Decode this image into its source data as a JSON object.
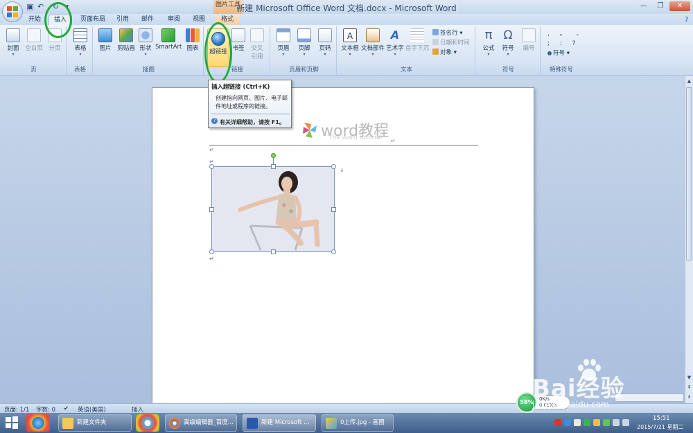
{
  "window": {
    "title": "新建 Microsoft Office Word 文档.docx - Microsoft Word",
    "context_tab_group": "图片工具"
  },
  "tabs": [
    "开始",
    "插入",
    "页面布局",
    "引用",
    "邮件",
    "审阅",
    "视图",
    "格式"
  ],
  "ribbon": {
    "groups": {
      "pages": {
        "label": "页",
        "items": [
          "封面",
          "空白页",
          "分页"
        ]
      },
      "tables": {
        "label": "表格",
        "items": [
          "表格"
        ]
      },
      "illustrations": {
        "label": "插图",
        "items": [
          "图片",
          "剪贴画",
          "形状",
          "SmartArt",
          "图表"
        ]
      },
      "links": {
        "label": "链接",
        "items": [
          "超链接",
          "书签",
          "交叉",
          "引用"
        ]
      },
      "header_footer": {
        "label": "页眉和页脚",
        "items": [
          "页眉",
          "页脚",
          "页码"
        ]
      },
      "text": {
        "label": "文本",
        "items": [
          "文本框",
          "文档部件",
          "艺术字",
          "首字下沉"
        ],
        "small": [
          "签名行",
          "日期和时间",
          "对象"
        ]
      },
      "symbols": {
        "label": "符号",
        "items": [
          "公式",
          "符号",
          "编号"
        ]
      },
      "special": {
        "label": "特殊符号",
        "items": [
          "符号"
        ]
      }
    }
  },
  "tooltip": {
    "title": "插入超链接 (Ctrl+K)",
    "body": "创建指向网页、图片、电子邮件地址或程序的链接。",
    "help": "有关详细帮助，请按 F1。"
  },
  "document": {
    "watermark_text": "word教程",
    "watermark_sub": "The word tutorial",
    "para_mark": "↵"
  },
  "statusbar": {
    "page": "页面: 1/1",
    "words": "字数: 0",
    "language": "英语(美国)",
    "mode": "插入"
  },
  "taskbar": {
    "tasks": [
      "新建文件夹",
      "高级编辑器_百度...",
      "新建 Microsoft ...",
      "0上传.jpg - 画图"
    ],
    "time": "15:51",
    "date": "2015/7/21 星期二"
  },
  "net_widget": {
    "percent": "58%",
    "up": "0K/s",
    "down": "0.05K/s"
  },
  "site_watermark": {
    "brand": "Bai经验",
    "url": "jingyan.baidu.com"
  },
  "colors": {
    "annotation": "#1faa3a",
    "hyperlink_highlight": "#ffd873",
    "ribbon_bg": "#dbe7f5"
  }
}
